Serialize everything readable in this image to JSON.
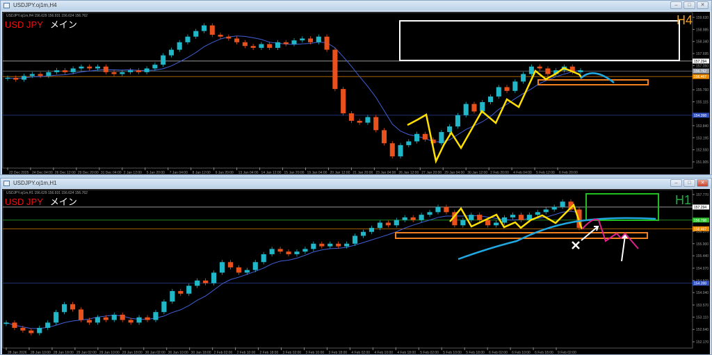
{
  "windows": [
    {
      "title": "USDJPY.oj1m,H4",
      "header": "USDJPY.oj1m,H4  156.629 156.931 156.624 156.762",
      "symbol": "USD JPY",
      "symbol_suffix": "メイン",
      "timeframe": "H4",
      "timeframe_color": "#f0a020"
    },
    {
      "title": "USDJPY.oj1m,H1",
      "header": "USDJPY.oj1m,H1  156.629 156.931 156.624 156.762",
      "symbol": "USD JPY",
      "symbol_suffix": "メイン",
      "timeframe": "H1",
      "timeframe_color": "#20b040"
    }
  ],
  "window_buttons": {
    "minimize": "–",
    "maximize": "□",
    "close": "✕"
  },
  "chart_data": [
    {
      "type": "candlestick",
      "title": "USDJPY.oj1m,H4",
      "ylim": [
        151.905,
        159.63
      ],
      "yticks": [
        "159.630",
        "158.985",
        "158.340",
        "157.695",
        "157.050",
        "155.760",
        "155.115",
        "153.840",
        "153.195",
        "152.550",
        "151.905"
      ],
      "xticks": [
        "22 Dec 2025",
        "24 Dec 04:00",
        "26 Dec 12:00",
        "29 Dec 20:00",
        "31 Dec 04:00",
        "2 Jan 12:00",
        "5 Jan 20:00",
        "7 Jan 04:00",
        "8 Jan 12:00",
        "9 Jan 20:00",
        "13 Jan 04:00",
        "14 Jan 12:00",
        "15 Jan 20:00",
        "19 Jan 04:00",
        "20 Jan 12:00",
        "21 Jan 20:00",
        "23 Jan 04:00",
        "26 Jan 12:00",
        "27 Jan 20:00",
        "29 Jan 04:00",
        "30 Jan 12:00",
        "2 Feb 20:00",
        "4 Feb 04:00",
        "5 Feb 12:00",
        "6 Feb 20:00"
      ],
      "closes": [
        156.4,
        156.3,
        156.5,
        156.6,
        156.5,
        156.7,
        156.8,
        156.7,
        156.9,
        157.0,
        156.9,
        157.0,
        156.7,
        156.6,
        156.7,
        156.8,
        156.7,
        156.9,
        157.1,
        157.6,
        157.9,
        158.3,
        158.6,
        158.9,
        159.2,
        158.7,
        158.6,
        158.5,
        158.3,
        158.1,
        158.0,
        158.2,
        158.0,
        158.3,
        158.2,
        158.4,
        158.5,
        158.3,
        158.6,
        157.9,
        155.8,
        154.5,
        154.1,
        154.0,
        154.3,
        153.6,
        152.9,
        152.2,
        152.8,
        153.0,
        153.4,
        153.1,
        152.9,
        153.5,
        153.8,
        154.4,
        155.0,
        154.6,
        155.1,
        155.4,
        155.9,
        155.7,
        156.2,
        156.6,
        157.0,
        156.9,
        156.6,
        156.8,
        157.0,
        156.7,
        156.8
      ],
      "levels": [
        {
          "value": "157.294",
          "color": "#ffffff"
        },
        {
          "value": "156.762",
          "color": "#9aa0a8"
        },
        {
          "value": "156.467",
          "color": "#f08c00"
        },
        {
          "value": "154.398",
          "color": "#3050c0"
        }
      ]
    },
    {
      "type": "candlestick",
      "title": "USDJPY.oj1m,H1",
      "ylim": [
        152.17,
        157.77
      ],
      "yticks": [
        "157.770",
        "156.370",
        "155.900",
        "155.440",
        "154.970",
        "154.500",
        "154.040",
        "153.570",
        "153.110",
        "152.640",
        "152.170"
      ],
      "xticks": [
        "28 Jan 2026",
        "28 Jan 10:00",
        "28 Jan 18:00",
        "29 Jan 02:00",
        "29 Jan 10:00",
        "29 Jan 18:00",
        "30 Jan 02:00",
        "30 Jan 10:00",
        "30 Jan 18:00",
        "2 Feb 02:00",
        "2 Feb 10:00",
        "2 Feb 18:00",
        "3 Feb 02:00",
        "3 Feb 10:00",
        "3 Feb 18:00",
        "4 Feb 02:00",
        "4 Feb 10:00",
        "4 Feb 18:00",
        "5 Feb 02:00",
        "5 Feb 10:00",
        "5 Feb 18:00",
        "6 Feb 02:00",
        "6 Feb 10:00",
        "6 Feb 18:00",
        "9 Feb 02:00"
      ],
      "closes": [
        152.9,
        152.7,
        152.6,
        152.5,
        152.7,
        152.9,
        153.3,
        153.6,
        153.4,
        153.0,
        152.9,
        153.1,
        153.0,
        153.2,
        153.0,
        152.9,
        153.1,
        153.0,
        153.3,
        153.7,
        154.1,
        154.0,
        154.3,
        154.5,
        154.4,
        154.8,
        155.2,
        155.0,
        154.8,
        154.9,
        155.2,
        155.5,
        155.7,
        155.6,
        155.5,
        155.6,
        155.7,
        155.9,
        155.8,
        155.9,
        155.8,
        155.9,
        156.2,
        156.35,
        156.5,
        156.7,
        156.6,
        156.8,
        156.9,
        156.8,
        157.0,
        157.1,
        157.3,
        157.1,
        156.6,
        156.8,
        157.0,
        156.8,
        156.6,
        156.7,
        156.9,
        157.0,
        156.8,
        157.0,
        157.1,
        157.2,
        157.3,
        157.5,
        157.2,
        156.5
      ],
      "levels": [
        {
          "value": "157.294",
          "color": "#ffffff"
        },
        {
          "value": "156.798",
          "color": "#30c030"
        },
        {
          "value": "156.467",
          "color": "#f08c00"
        },
        {
          "value": "154.398",
          "color": "#3050c0"
        }
      ]
    }
  ]
}
